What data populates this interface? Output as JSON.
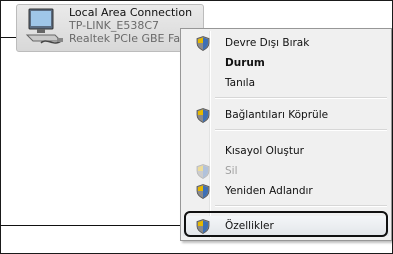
{
  "connection": {
    "name": "Local Area Connection",
    "network": "TP-LINK_E538C7",
    "adapter": "Realtek PCIe GBE Fam",
    "icon": "network-adapter-icon"
  },
  "menu": {
    "items": [
      {
        "label": "Devre Dışı Bırak",
        "icon": "shield-icon",
        "bold": false,
        "disabled": false
      },
      {
        "label": "Durum",
        "icon": "",
        "bold": true,
        "disabled": false
      },
      {
        "label": "Tanıla",
        "icon": "",
        "bold": false,
        "disabled": false
      },
      {
        "label": "Bağlantıları Köprüle",
        "icon": "shield-icon",
        "bold": false,
        "disabled": false
      },
      {
        "label": "Kısayol Oluştur",
        "icon": "",
        "bold": false,
        "disabled": false
      },
      {
        "label": "Sil",
        "icon": "shield-icon",
        "bold": false,
        "disabled": true
      },
      {
        "label": "Yeniden Adlandır",
        "icon": "shield-icon",
        "bold": false,
        "disabled": false
      },
      {
        "label": "Özellikler",
        "icon": "shield-icon",
        "bold": false,
        "disabled": false,
        "highlighted": true
      }
    ]
  }
}
